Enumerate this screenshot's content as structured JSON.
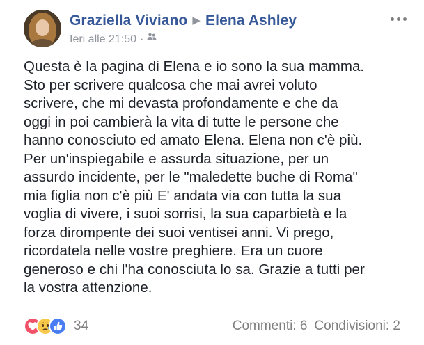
{
  "post": {
    "author": "Graziella Viviano",
    "recipient": "Elena Ashley",
    "timestamp": "Ieri alle 21:50",
    "separator": "·",
    "audience_icon": "friends-icon",
    "more_icon": "more-options-icon",
    "body": "Questa è la pagina di Elena e io sono la sua mamma.\nSto per scrivere qualcosa che mai avrei voluto\nscrivere, che mi devasta profondamente e che da\noggi in poi cambierà la vita di tutte le persone che\nhanno conosciuto ed amato Elena. Elena non c'è più.\nPer un'inspiegabile e assurda situazione, per un\nassurdo incidente, per le \"maledette buche di Roma\"\nmia figlia non c'è più E' andata via con tutta la sua\nvoglia di vivere, i suoi sorrisi, la sua caparbietà e la\nforza dirompente dei suoi ventisei anni. Vi prego,\nricordatela nelle vostre preghiere. Era un cuore\ngeneroso e chi l'ha conosciuta lo sa. Grazie a tutti per\nla vostra attenzione."
  },
  "footer": {
    "reactions": [
      "love",
      "sad",
      "like"
    ],
    "reaction_count": "34",
    "comments": "Commenti: 6",
    "shares": "Condivisioni: 2"
  },
  "colors": {
    "name": "#365899",
    "meta": "#90949c",
    "body": "#1d2129",
    "love": "#f25268",
    "sad": "#f7c94b",
    "like": "#4a7cf3"
  }
}
